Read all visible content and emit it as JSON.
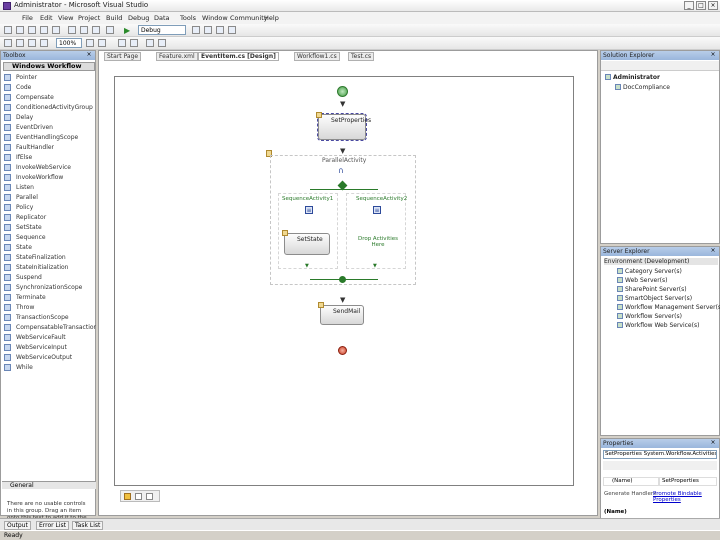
{
  "window": {
    "title": "Administrator - Microsoft Visual Studio"
  },
  "menu": [
    "File",
    "Edit",
    "View",
    "Project",
    "Build",
    "Debug",
    "Data",
    "Tools",
    "Window",
    "Community",
    "Help"
  ],
  "toolbar": {
    "config": "Debug",
    "zoom": "100%"
  },
  "toolbox": {
    "title": "Toolbox",
    "category": "Windows Workflow",
    "items": [
      "Pointer",
      "Code",
      "Compensate",
      "ConditionedActivityGroup",
      "Delay",
      "EventDriven",
      "EventHandlingScope",
      "FaultHandler",
      "IfElse",
      "InvokeWebService",
      "InvokeWorkflow",
      "Listen",
      "Parallel",
      "Policy",
      "Replicator",
      "SetState",
      "Sequence",
      "State",
      "StateFinalization",
      "StateInitialization",
      "Suspend",
      "SynchronizationScope",
      "Terminate",
      "Throw",
      "TransactionScope",
      "CompensatableTransactionScope",
      "WebServiceFault",
      "WebServiceInput",
      "WebServiceOutput",
      "While"
    ],
    "general": "General",
    "general_text": "There are no usable controls in this group. Drag an item onto this text to add it to the toolbox."
  },
  "tabs": [
    "Start Page",
    "Feature.xml",
    "EventItem.cs [Design]",
    "Workflow1.cs",
    "Test.cs"
  ],
  "workflow": {
    "set_props": "SetProperties",
    "parallel": "ParallelActivity",
    "left_branch": "SequenceActivity1",
    "right_branch": "SequenceActivity2",
    "left_act": "SetState",
    "right_drop": "Drop Activities Here",
    "send_mail": "SendMail"
  },
  "explorer": {
    "title": "Solution Explorer",
    "root": "Administrator",
    "child": "DocCompliance"
  },
  "server": {
    "title": "Server Explorer",
    "root": "Environment (Development)",
    "items": [
      "Category Server(s)",
      "Web Server(s)",
      "SharePoint Server(s)",
      "SmartObject Server(s)",
      "Workflow Management Server(s)",
      "Workflow Server(s)",
      "Workflow Web Service(s)"
    ]
  },
  "properties": {
    "title": "Properties",
    "object": "SetProperties System.Workflow.Activities",
    "name_row": "(Name)",
    "name_val": "SetProperties",
    "generate_link": "Promote Bindable Properties",
    "generate_label": "Generate Handlers",
    "footer": "(Name)"
  },
  "bottom": {
    "tabs": [
      "Output",
      "Error List",
      "Task List"
    ],
    "status": "Ready"
  }
}
